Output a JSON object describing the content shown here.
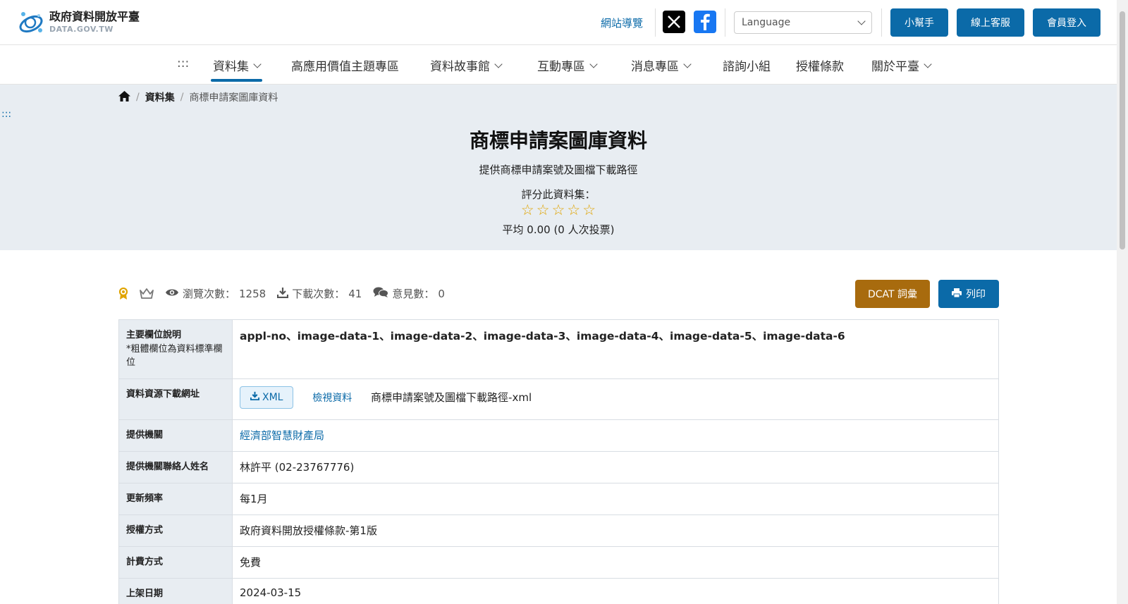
{
  "header": {
    "logo_title": "政府資料開放平臺",
    "logo_sub": "DATA.GOV.TW",
    "sitemap": "網站導覽",
    "language_placeholder": "Language",
    "helper_btn": "小幫手",
    "service_btn": "線上客服",
    "login_btn": "會員登入"
  },
  "nav": {
    "anchor": ":::",
    "items": [
      {
        "label": "資料集",
        "dropdown": true,
        "active": true
      },
      {
        "label": "高應用價值主題專區",
        "dropdown": false
      },
      {
        "label": "資料故事館",
        "dropdown": true
      },
      {
        "label": "互動專區",
        "dropdown": true
      },
      {
        "label": "消息專區",
        "dropdown": true
      },
      {
        "label": "諮詢小組",
        "dropdown": false
      },
      {
        "label": "授權條款",
        "dropdown": false
      },
      {
        "label": "關於平臺",
        "dropdown": true
      }
    ]
  },
  "breadcrumb": {
    "items": [
      "資料集",
      "商標申請案圖庫資料"
    ]
  },
  "side_anchor": ":::",
  "hero": {
    "title": "商標申請案圖庫資料",
    "subtitle": "提供商標申請案號及圖檔下載路徑",
    "rate_label": "評分此資料集：",
    "stars": 0,
    "stars_max": 5,
    "average_text": "平均 0.00 (0 人次投票)"
  },
  "stats": {
    "views_label": "瀏覽次數：",
    "views": "1258",
    "downloads_label": "下載次數：",
    "downloads": "41",
    "comments_label": "意見數：",
    "comments": "0"
  },
  "actions": {
    "dcat": "DCAT 詞彙",
    "print": "列印"
  },
  "table": {
    "fields_label": "主要欄位說明",
    "fields_note": "*粗體欄位為資料標準欄位",
    "fields_value": "appl-no、image-data-1、image-data-2、image-data-3、image-data-4、image-data-5、image-data-6",
    "resource_label": "資料資源下載網址",
    "resource_format": "XML",
    "resource_view": "檢視資料",
    "resource_desc": "商標申請案號及圖檔下載路徑-xml",
    "provider_label": "提供機關",
    "provider_value": "經濟部智慧財產局",
    "contact_label": "提供機關聯絡人姓名",
    "contact_value": "林許平 (02-23767776)",
    "frequency_label": "更新頻率",
    "frequency_value": "每1月",
    "license_label": "授權方式",
    "license_value": "政府資料開放授權條款-第1版",
    "fee_label": "計費方式",
    "fee_value": "免費",
    "date_label": "上架日期",
    "date_value": "2024-03-15"
  },
  "colors": {
    "primary": "#0b6aa8",
    "dcat": "#a86b0e",
    "hero_bg": "#e8edf2",
    "star": "#e0a400"
  }
}
